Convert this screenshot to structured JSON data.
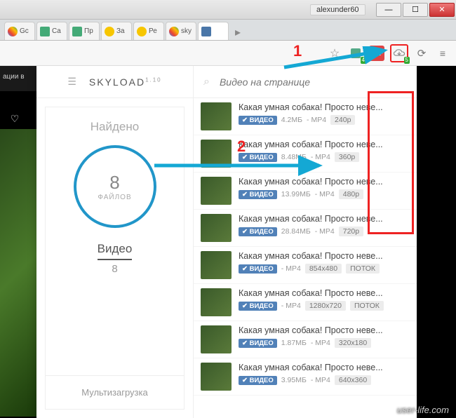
{
  "window": {
    "user": "alexunder60"
  },
  "tabs": [
    {
      "label": "Gc"
    },
    {
      "label": "Ca"
    },
    {
      "label": "Пр"
    },
    {
      "label": "За"
    },
    {
      "label": "Ре"
    },
    {
      "label": "sky"
    },
    {
      "label": ""
    }
  ],
  "toolbar": {
    "ext1_badge": "4",
    "abp": "ABP",
    "skyload_badge": "5"
  },
  "skyload": {
    "brand": "SKYLOAD",
    "brand_sup": "1.10",
    "found_label": "Найдено",
    "count": "8",
    "count_label": "ФАЙЛОВ",
    "category": "Видео",
    "category_count": "8",
    "multi_label": "Мультизагрузка",
    "search_placeholder": "Видео на странице"
  },
  "items": [
    {
      "title": "Какая умная собака! Просто неве...",
      "src": "ВИДЕО",
      "size": "4.2МБ",
      "fmt": "MP4",
      "res": "240p"
    },
    {
      "title": "Какая умная собака! Просто неве...",
      "src": "ВИДЕО",
      "size": "8.48МБ",
      "fmt": "MP4",
      "res": "360p"
    },
    {
      "title": "Какая умная собака! Просто неве...",
      "src": "ВИДЕО",
      "size": "13.99МБ",
      "fmt": "MP4",
      "res": "480p"
    },
    {
      "title": "Какая умная собака! Просто неве...",
      "src": "ВИДЕО",
      "size": "28.84МБ",
      "fmt": "MP4",
      "res": "720p"
    },
    {
      "title": "Какая умная собака! Просто неве...",
      "src": "ВИДЕО",
      "size": "",
      "fmt": "MP4",
      "res": "854x480",
      "extra": "ПОТОК"
    },
    {
      "title": "Какая умная собака! Просто неве...",
      "src": "ВИДЕО",
      "size": "",
      "fmt": "MP4",
      "res": "1280x720",
      "extra": "ПОТОК"
    },
    {
      "title": "Какая умная собака! Просто неве...",
      "src": "ВИДЕО",
      "size": "1.87МБ",
      "fmt": "MP4",
      "res": "320x180"
    },
    {
      "title": "Какая умная собака! Просто неве...",
      "src": "ВИДЕО",
      "size": "3.95МБ",
      "fmt": "MP4",
      "res": "640x360"
    }
  ],
  "bg_text": "ации в",
  "annotations": {
    "one": "1",
    "two": "2"
  },
  "watermark": "user-life.com"
}
